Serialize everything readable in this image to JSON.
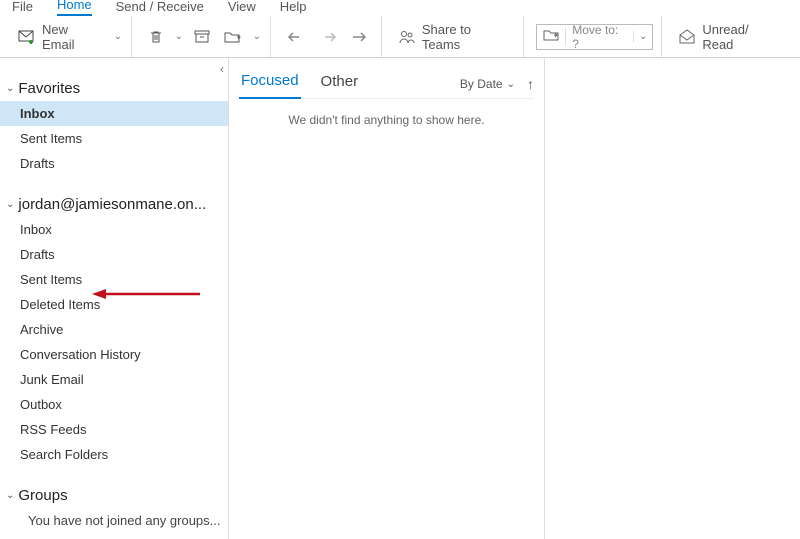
{
  "ribbon_tabs": {
    "file": "File",
    "home": "Home",
    "send_receive": "Send / Receive",
    "view": "View",
    "help": "Help"
  },
  "toolbar": {
    "new_email": "New Email",
    "share_to_teams": "Share to Teams",
    "move_to": "Move to: ?",
    "unread_read": "Unread/ Read"
  },
  "sidebar": {
    "favorites_label": "Favorites",
    "favorites": {
      "inbox": "Inbox",
      "sent": "Sent Items",
      "drafts": "Drafts"
    },
    "account_label": "jordan@jamiesonmane.on...",
    "account": {
      "inbox": "Inbox",
      "drafts": "Drafts",
      "sent": "Sent Items",
      "deleted": "Deleted Items",
      "archive": "Archive",
      "conv_hist": "Conversation History",
      "junk": "Junk Email",
      "outbox": "Outbox",
      "rss": "RSS Feeds",
      "search": "Search Folders"
    },
    "groups_label": "Groups",
    "groups_empty": "You have not joined any groups..."
  },
  "list": {
    "tab_focused": "Focused",
    "tab_other": "Other",
    "sort_label": "By Date",
    "empty": "We didn't find anything to show here."
  }
}
